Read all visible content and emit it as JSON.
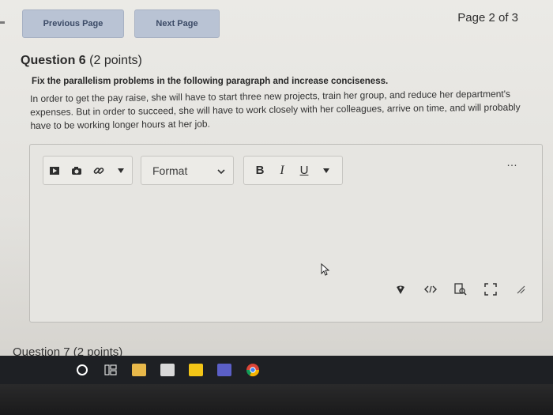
{
  "nav": {
    "previous_label": "Previous Page",
    "next_label": "Next Page",
    "page_indicator": "Page 2 of 3"
  },
  "question": {
    "title": "Question 6",
    "points": "(2 points)",
    "instruction": "Fix the parallelism problems in the following paragraph and increase conciseness.",
    "paragraph": "In order to get the pay raise, she will have to start three new projects, train her group, and reduce her department's expenses. But in order to succeed, she will have to work closely with her colleagues, arrive on time, and will probably have to be working longer hours at her job."
  },
  "editor": {
    "toolbar_icons": [
      "video-icon",
      "camera-icon",
      "link-icon",
      "caret-down-icon"
    ],
    "format_select": {
      "selected": "Format"
    },
    "formatting_buttons": [
      "B",
      "I",
      "U"
    ],
    "more_glyph": "…",
    "bottom_icons": [
      "accessibility-icon",
      "code-view-icon",
      "find-replace-icon",
      "fullscreen-icon",
      "resize-handle-icon"
    ]
  },
  "next_question_partial": "Question 7 (2 points)",
  "taskbar_icons": [
    "cortana-icon",
    "task-view-icon",
    "file-explorer-icon",
    "store-icon",
    "sticky-notes-icon",
    "teams-icon",
    "chrome-icon"
  ],
  "colors": {
    "nav_button_bg": "#b9c3d4",
    "page_bg": "#e6e5e1",
    "taskbar_bg": "#1e2024"
  }
}
